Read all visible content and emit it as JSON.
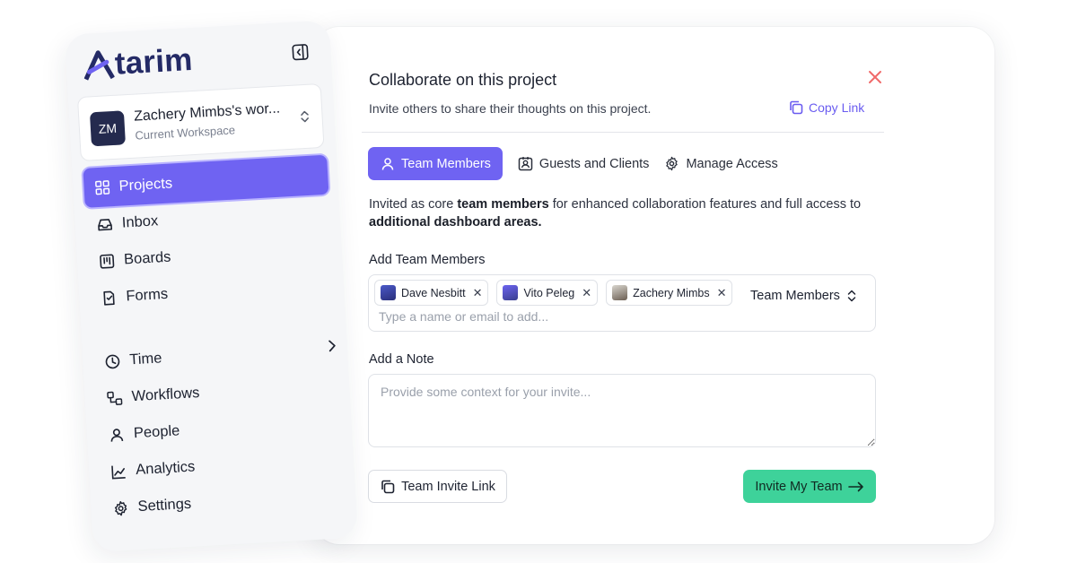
{
  "sidebar": {
    "logo": "tarim",
    "workspace": {
      "initials": "ZM",
      "name": "Zachery Mimbs's wor...",
      "subtitle": "Current Workspace"
    },
    "items": [
      {
        "label": "Projects",
        "icon": "grid-icon",
        "active": true
      },
      {
        "label": "Inbox",
        "icon": "inbox-icon"
      },
      {
        "label": "Boards",
        "icon": "board-icon"
      },
      {
        "label": "Forms",
        "icon": "form-icon"
      },
      {
        "label": "Time",
        "icon": "clock-icon"
      },
      {
        "label": "Workflows",
        "icon": "workflow-icon"
      },
      {
        "label": "People",
        "icon": "person-icon"
      },
      {
        "label": "Analytics",
        "icon": "chart-icon"
      },
      {
        "label": "Settings",
        "icon": "gear-icon"
      }
    ]
  },
  "modal": {
    "title": "Collaborate on this project",
    "subtitle": "Invite others to share their thoughts on this project.",
    "copy_link": "Copy Link",
    "tabs": [
      {
        "label": "Team Members",
        "active": true
      },
      {
        "label": "Guests and Clients"
      },
      {
        "label": "Manage Access"
      }
    ],
    "description": {
      "part1": "Invited as core ",
      "bold1": "team members",
      "part2": " for enhanced collaboration features and full access to ",
      "bold2": "additional dashboard areas."
    },
    "add_members_label": "Add Team Members",
    "members": [
      {
        "name": "Dave Nesbitt"
      },
      {
        "name": "Vito Peleg"
      },
      {
        "name": "Zachery Mimbs"
      }
    ],
    "member_input_placeholder": "Type a name or email to add...",
    "role_select": "Team Members",
    "note_label": "Add a Note",
    "note_placeholder": "Provide some context for your invite...",
    "team_invite_link": "Team Invite Link",
    "invite_button": "Invite My Team"
  },
  "colors": {
    "accent": "#6f63f2",
    "invite": "#3ed29a",
    "close": "#f06a6a",
    "logo": "#242a66"
  }
}
